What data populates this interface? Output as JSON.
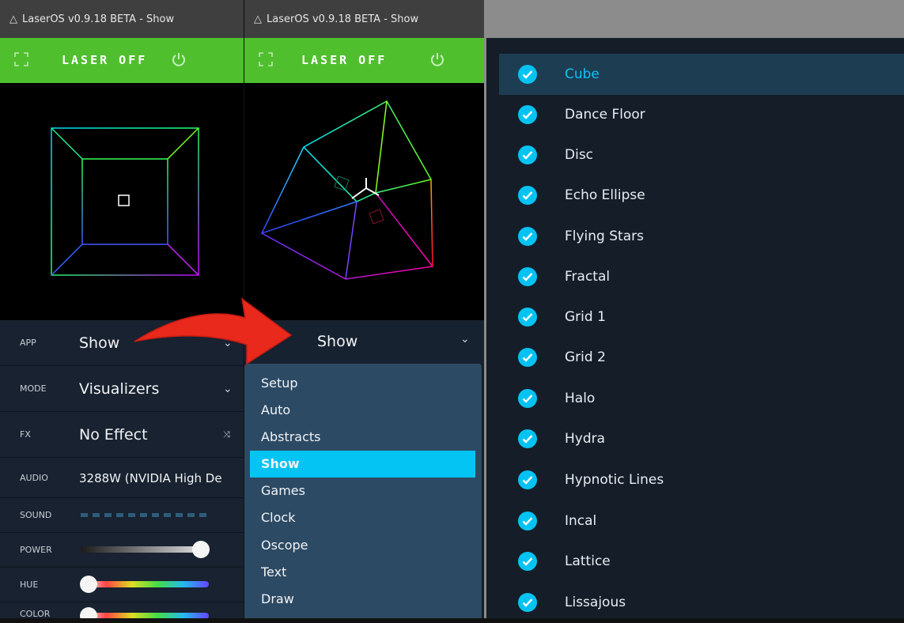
{
  "left_window": {
    "title": "LaserOS v0.9.18 BETA - Show",
    "laser_status": "LASER OFF",
    "settings": [
      {
        "label": "APP",
        "value": "Show"
      },
      {
        "label": "MODE",
        "value": "Visualizers"
      },
      {
        "label": "FX",
        "value": "No Effect"
      },
      {
        "label": "AUDIO",
        "value": "3288W (NVIDIA High De"
      },
      {
        "label": "SOUND",
        "value": ""
      },
      {
        "label": "POWER",
        "value": ""
      },
      {
        "label": "HUE",
        "value": ""
      },
      {
        "label": "COLOR",
        "value": ""
      }
    ],
    "power_level": 0.98,
    "hue_level": 0.05,
    "color_level": 0.05
  },
  "middle_window": {
    "title": "LaserOS v0.9.18 BETA - Show",
    "laser_status": "LASER OFF",
    "app_value": "Show",
    "menu_items": [
      "Setup",
      "Auto",
      "Abstracts",
      "Show",
      "Games",
      "Clock",
      "Oscope",
      "Text",
      "Draw"
    ],
    "menu_selected": "Show"
  },
  "show_list": {
    "items": [
      "Cube",
      "Dance Floor",
      "Disc",
      "Echo Ellipse",
      "Flying Stars",
      "Fractal",
      "Grid 1",
      "Grid 2",
      "Halo",
      "Hydra",
      "Hypnotic Lines",
      "Incal",
      "Lattice",
      "Lissajous"
    ],
    "active": "Cube"
  },
  "colors": {
    "green_bar": "#4fbf2e",
    "accent": "#04c4f4",
    "panel": "#182230",
    "arrow": "#e8291c"
  }
}
